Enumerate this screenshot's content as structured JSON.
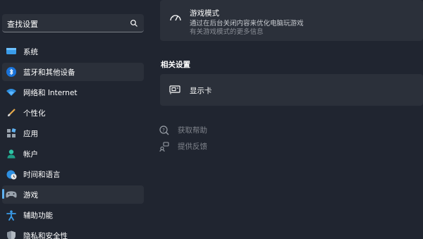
{
  "search": {
    "placeholder": "查找设置"
  },
  "nav": [
    {
      "label": "系统",
      "icon": "monitor-icon"
    },
    {
      "label": "蓝牙和其他设备",
      "icon": "bluetooth-icon"
    },
    {
      "label": "网络和 Internet",
      "icon": "wifi-icon"
    },
    {
      "label": "个性化",
      "icon": "brush-icon"
    },
    {
      "label": "应用",
      "icon": "apps-icon"
    },
    {
      "label": "帐户",
      "icon": "account-icon"
    },
    {
      "label": "时间和语言",
      "icon": "globe-clock-icon"
    },
    {
      "label": "游戏",
      "icon": "gamepad-icon"
    },
    {
      "label": "辅助功能",
      "icon": "accessibility-icon"
    },
    {
      "label": "隐私和安全性",
      "icon": "shield-icon"
    }
  ],
  "game_mode": {
    "title": "游戏模式",
    "description": "通过在后台关闭内容来优化电脑玩游戏",
    "link": "有关游戏模式的更多信息",
    "icon": "speedometer-icon"
  },
  "related": {
    "title": "相关设置",
    "items": [
      {
        "label": "显示卡",
        "icon": "graphics-card-icon"
      }
    ]
  },
  "help": [
    {
      "label": "获取帮助",
      "icon": "help-icon"
    },
    {
      "label": "提供反馈",
      "icon": "feedback-icon"
    }
  ],
  "colors": {
    "background": "#202530",
    "card": "#2b303a",
    "accent": "#5fb2f2"
  }
}
